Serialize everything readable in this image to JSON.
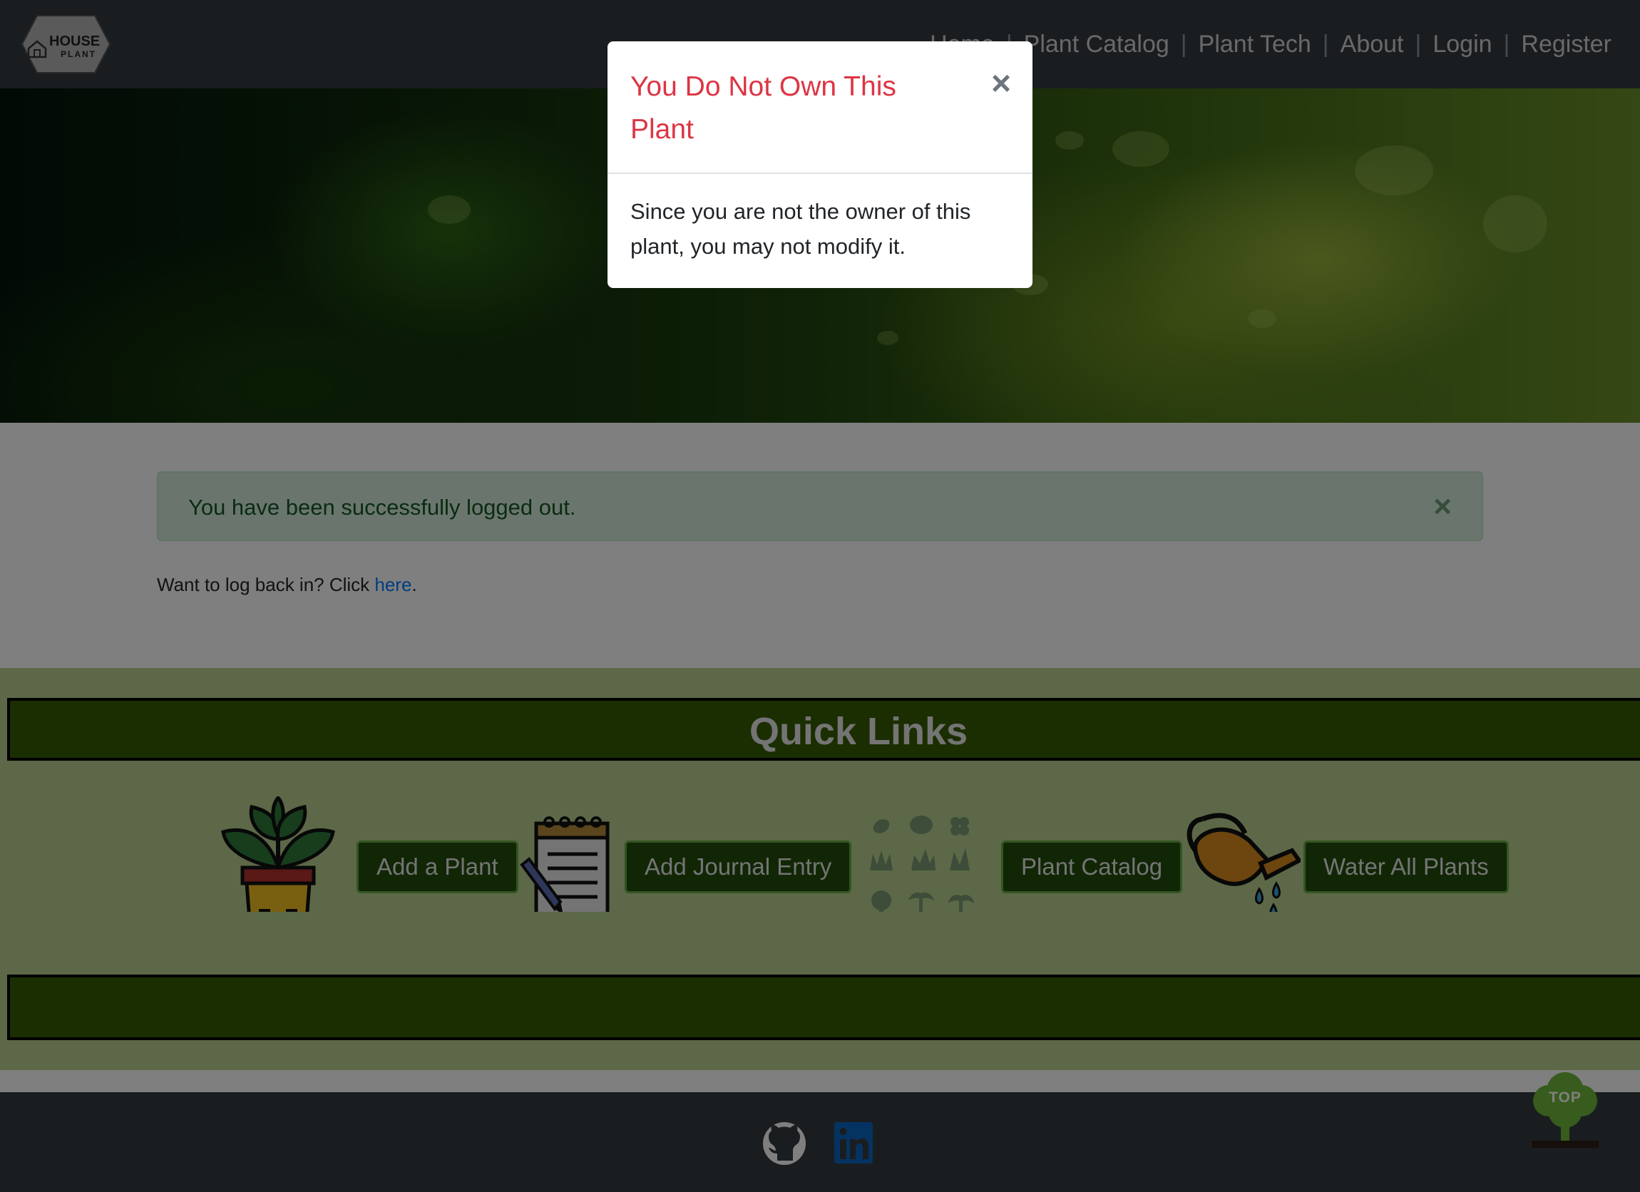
{
  "navbar": {
    "logo": {
      "line1": "HOUSE",
      "line2": "PLANT",
      "icon": "house-icon"
    },
    "links": [
      "Home",
      "Plant Catalog",
      "Plant Tech",
      "About",
      "Login",
      "Register"
    ],
    "separator": "|"
  },
  "alert": {
    "message": "You have been successfully logged out.",
    "close": "×",
    "close_icon": "close-icon"
  },
  "login_hint": {
    "text": "Want to log back in? Click ",
    "link": "here",
    "suffix": "."
  },
  "quick_links": {
    "title": "Quick Links",
    "items": [
      {
        "label": "Add a Plant",
        "icon": "potted-plant-icon"
      },
      {
        "label": "Add Journal Entry",
        "icon": "notepad-pencil-icon"
      },
      {
        "label": "Plant Catalog",
        "icon": "plant-varieties-icon"
      },
      {
        "label": "Water All Plants",
        "icon": "watering-can-icon"
      }
    ]
  },
  "footer": {
    "icons": [
      "github-icon",
      "linkedin-icon"
    ]
  },
  "top_button": {
    "label": "TOP",
    "icon": "tree-icon"
  },
  "modal": {
    "title": "You Do Not Own This Plant",
    "close": "×",
    "body": "Since you are not the owner of this plant, you may not modify it."
  },
  "colors": {
    "navbar_bg": "#343a40",
    "alert_bg": "#d4edda",
    "alert_text": "#155724",
    "quick_links_bg": "#b8d18f",
    "quick_links_bar": "#365c04",
    "button_bg": "#224d0a",
    "modal_title": "#dc3545",
    "link": "#007bff"
  }
}
